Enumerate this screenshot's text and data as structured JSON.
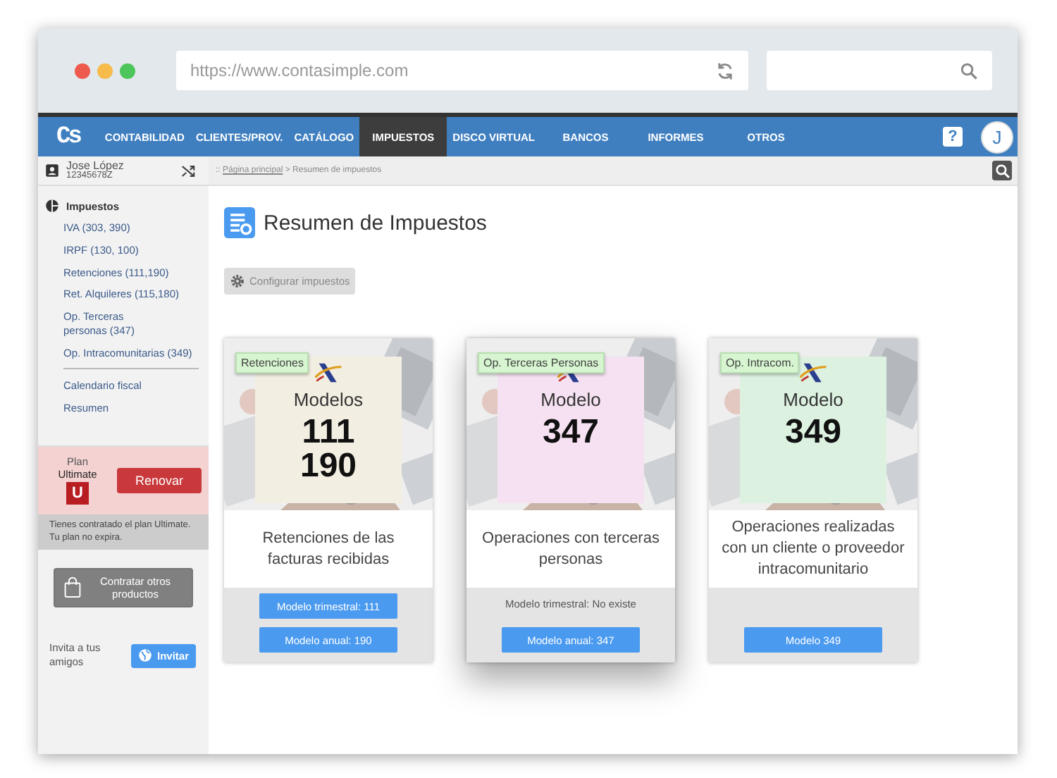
{
  "browser": {
    "url": "https://www.contasimple.com"
  },
  "nav": {
    "logo": "Cs",
    "items": [
      {
        "label": "CONTABILIDAD",
        "selected": false
      },
      {
        "label": "CLIENTES/PROV.",
        "selected": false
      },
      {
        "label": "CATÁLOGO",
        "selected": false
      },
      {
        "label": "IMPUESTOS",
        "selected": true
      },
      {
        "label": "DISCO VIRTUAL",
        "selected": false
      },
      {
        "label": "BANCOS",
        "selected": false
      },
      {
        "label": "INFORMES",
        "selected": false
      },
      {
        "label": "OTROS",
        "selected": false
      }
    ],
    "help": "?",
    "avatar": "J"
  },
  "user": {
    "name": "Jose López",
    "id": "12345678Z"
  },
  "breadcrumb": {
    "prefix": "::",
    "link": "Página principal",
    "rest": "> Resumen de impuestos"
  },
  "sidebar": {
    "section": "Impuestos",
    "items": [
      "IVA (303, 390)",
      "IRPF (130, 100)",
      "Retenciones (111,190)",
      "Ret. Alquileres (115,180)",
      "Op. Terceras personas (347)",
      "Op. Intracomunitarias (349)"
    ],
    "extra_items": [
      "Calendario fiscal",
      "Resumen"
    ]
  },
  "plan": {
    "label": "Plan",
    "name": "Ultimate",
    "badge": "U",
    "renew": "Renovar",
    "note": "Tienes contratado el plan Ultimate. Tu plan no expira."
  },
  "shop_button": "Contratar otros productos",
  "invite": {
    "text": "Invita a tus amigos",
    "button": "Invitar"
  },
  "page": {
    "title": "Resumen de Impuestos",
    "config_button": "Configurar impuestos"
  },
  "cards": [
    {
      "tag": "Retenciones",
      "heading": "Modelos",
      "numbers": [
        "111",
        "190"
      ],
      "color": "#f3eee2",
      "raised": false,
      "description": "Retenciones de las facturas recibidas",
      "footer": [
        {
          "kind": "button",
          "text": "Modelo trimestral: 111"
        },
        {
          "kind": "button",
          "text": "Modelo anual: 190"
        }
      ]
    },
    {
      "tag": "Op. Terceras Personas",
      "heading": "Modelo",
      "numbers": [
        "347"
      ],
      "color": "#f5e1f1",
      "raised": true,
      "description": "Operaciones con terceras personas",
      "footer": [
        {
          "kind": "note",
          "text": "Modelo trimestral: No existe"
        },
        {
          "kind": "button",
          "text": "Modelo anual: 347"
        }
      ]
    },
    {
      "tag": "Op. Intracom.",
      "heading": "Modelo",
      "numbers": [
        "349"
      ],
      "color": "#dcf1e0",
      "raised": false,
      "description": "Operaciones realizadas con un cliente o proveedor intracomunitario",
      "footer": [
        {
          "kind": "button",
          "text": "Modelo 349"
        }
      ]
    }
  ]
}
